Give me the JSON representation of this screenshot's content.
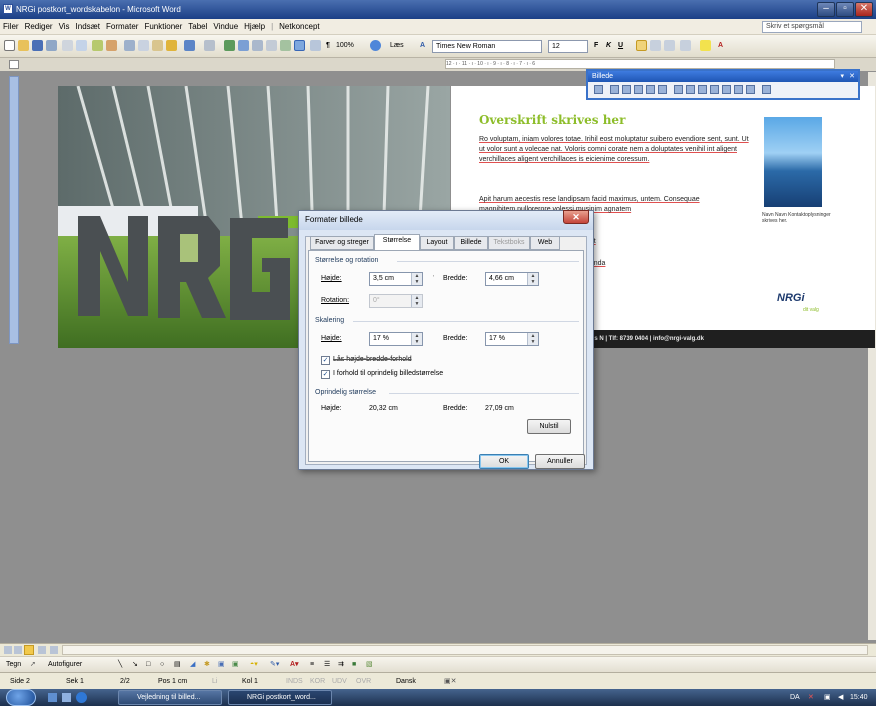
{
  "window": {
    "title": "NRGi postkort_wordskabelon - Microsoft Word",
    "app_icon": "W"
  },
  "menu": [
    "Filer",
    "Rediger",
    "Vis",
    "Indsæt",
    "Formater",
    "Funktioner",
    "Tabel",
    "Vindue",
    "Hjælp",
    "Netkoncept"
  ],
  "help_placeholder": "Skriv et spørgsmål",
  "toolbar": {
    "zoom": "100%",
    "read_label": "Læs",
    "font": "Times New Roman",
    "size": "12"
  },
  "ruler_text": "12 · ı · 11 · ı · 10 · ı · 9 · ı · 8 · ı · 7 · ı · 6",
  "document": {
    "photo_text": "NRGi",
    "heading": "Overskrift skrives her",
    "para1": "Ro voluptam, iniam volores totae. Irihil eost moluptatur suibero evendiore sent, sunt. Ut ut volor sunt a volecae nat. Voloris comni corate nem a doluptates venihil int aligent verchillaces aligent verchillaces is eicienime coressum.",
    "para2": "Apit harum aecestis rese landipsam facid maximus, untem. Consequae magnihitem nullorerore volessi musinim agnatem",
    "para3": "...at",
    "para4": "...anda",
    "caption": "Navn Navn Kontaktoplysninger skrives her.",
    "logo": "NRGi",
    "logo_sub": "dit valg",
    "footer": "hus N  |  Tlf: 8739 0404  |  info@nrgi-valg.dk"
  },
  "picture_toolbar": {
    "title": "Billede"
  },
  "dialog": {
    "title": "Formater billede",
    "tabs": [
      {
        "label": "Farver og streger",
        "state": "normal"
      },
      {
        "label": "Størrelse",
        "state": "active"
      },
      {
        "label": "Layout",
        "state": "normal"
      },
      {
        "label": "Billede",
        "state": "normal"
      },
      {
        "label": "Tekstboks",
        "state": "disabled"
      },
      {
        "label": "Web",
        "state": "normal"
      }
    ],
    "size_rotation": {
      "title": "Størrelse og rotation",
      "height_label": "Højde:",
      "height_value": "3,5 cm",
      "width_label": "Bredde:",
      "width_value": "4,66 cm",
      "rotation_label": "Rotation:",
      "rotation_value": "0°"
    },
    "scale": {
      "title": "Skalering",
      "height_label": "Højde:",
      "height_value": "17 %",
      "width_label": "Bredde:",
      "width_value": "17 %",
      "lock_label": "Lås højde-bredde-forhold",
      "lock_checked": true,
      "relative_label": "I forhold til oprindelig billedstørrelse",
      "relative_checked": true
    },
    "original": {
      "title": "Oprindelig størrelse",
      "height_label": "Højde:",
      "height_value": "20,32 cm",
      "width_label": "Bredde:",
      "width_value": "27,09 cm",
      "reset_label": "Nulstil"
    },
    "ok_label": "OK",
    "cancel_label": "Annuller"
  },
  "drawbar": {
    "draw": "Tegn",
    "autoshapes": "Autofigurer"
  },
  "status": {
    "page": "Side 2",
    "section": "Sek 1",
    "pages": "2/2",
    "pos": "Pos 1 cm",
    "line": "Li",
    "col": "Kol 1",
    "modes": [
      "INDS",
      "KOR",
      "UDV",
      "OVR"
    ],
    "language": "Dansk"
  },
  "taskbar": {
    "items": [
      "Vejledning til billed...",
      "NRGi postkort_word..."
    ],
    "lang": "DA",
    "time": "15:40"
  }
}
